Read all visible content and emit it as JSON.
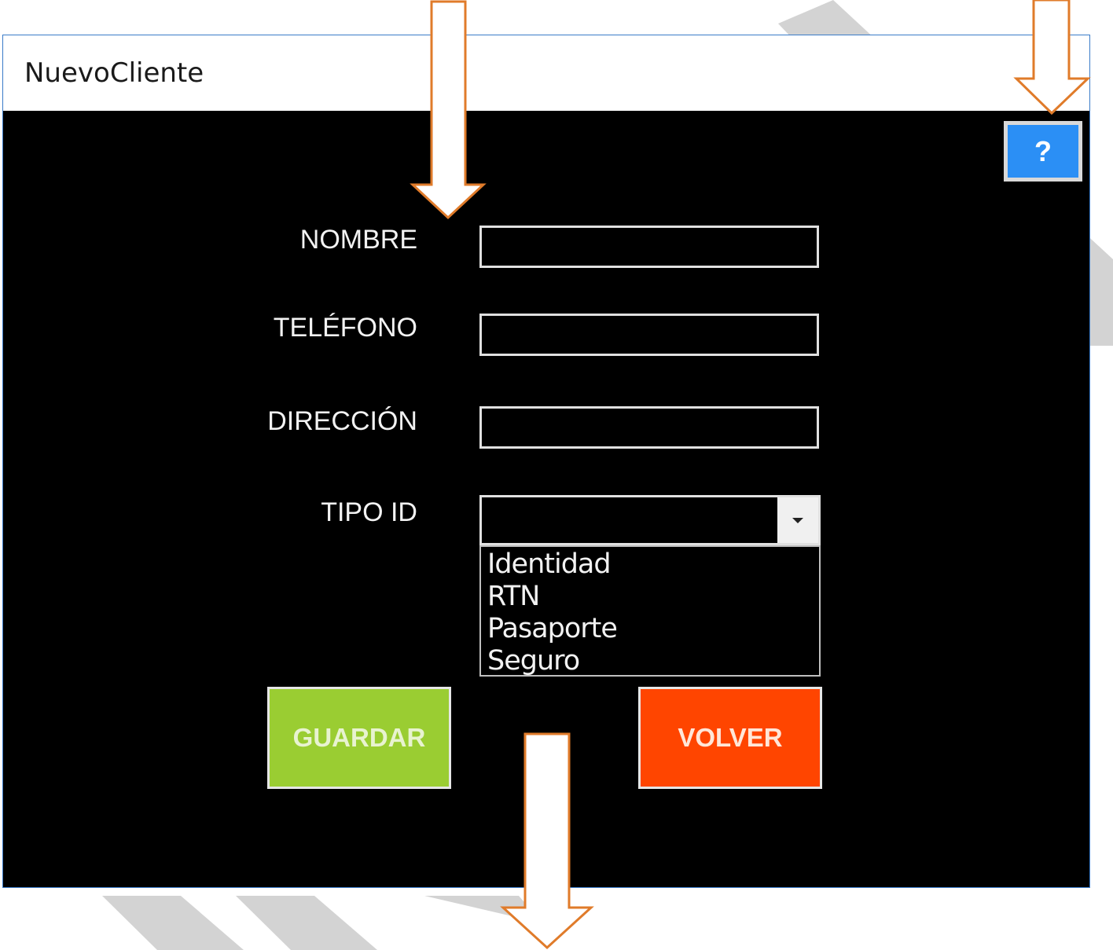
{
  "window": {
    "title": "NuevoCliente"
  },
  "help_button": {
    "label": "?"
  },
  "form": {
    "fields": [
      {
        "label": "NOMBRE",
        "value": ""
      },
      {
        "label": "TELÉFONO",
        "value": ""
      },
      {
        "label": "DIRECCIÓN",
        "value": ""
      }
    ],
    "tipo_id": {
      "label": "TIPO ID",
      "value": "",
      "options": [
        "Identidad",
        "RTN",
        "Pasaporte",
        "Seguro"
      ]
    }
  },
  "buttons": {
    "guardar": "GUARDAR",
    "volver": "VOLVER"
  },
  "colors": {
    "guardar_bg": "#9acd32",
    "volver_bg": "#ff4500",
    "help_bg": "#2b8ff5",
    "annotation_arrow": "#e07b2a"
  }
}
